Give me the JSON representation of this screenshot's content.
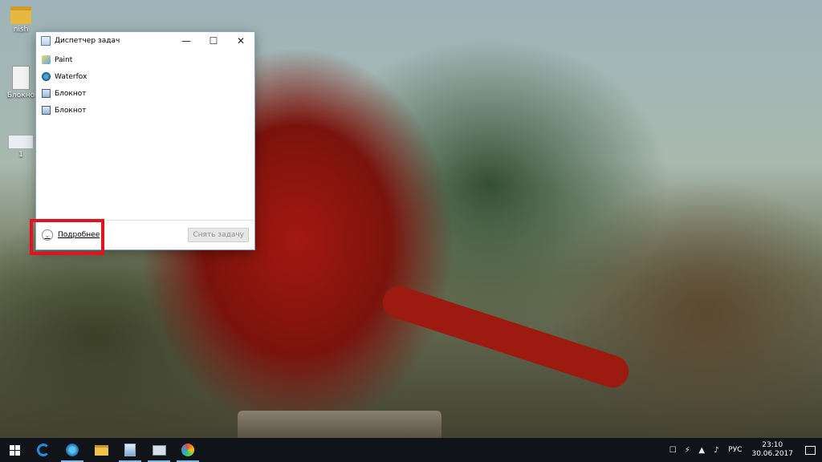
{
  "desktop": {
    "icons": [
      {
        "label": "nish",
        "icon": "folder-icon"
      },
      {
        "label": "Блокно",
        "icon": "document-icon"
      },
      {
        "label": "1",
        "icon": "text-file-icon"
      }
    ]
  },
  "task_manager": {
    "title": "Диспетчер задач",
    "controls": {
      "minimize": "—",
      "maximize": "☐",
      "close": "✕"
    },
    "apps": [
      {
        "name": "Paint",
        "icon": "paint-icon"
      },
      {
        "name": "Waterfox",
        "icon": "waterfox-icon"
      },
      {
        "name": "Блокнот",
        "icon": "notepad-icon"
      },
      {
        "name": "Блокнот",
        "icon": "notepad-icon"
      }
    ],
    "more_details_label": "Подробнее",
    "end_task_label": "Снять задачу"
  },
  "highlight_color": "#e3121d",
  "taskbar": {
    "apps": [
      "start-icon",
      "edge-icon",
      "waterfox-icon",
      "file-explorer-icon",
      "notepad-icon",
      "task-manager-icon",
      "paint-icon"
    ],
    "tray": {
      "language": "РУС",
      "time": "23:10",
      "date": "30.06.2017"
    }
  }
}
